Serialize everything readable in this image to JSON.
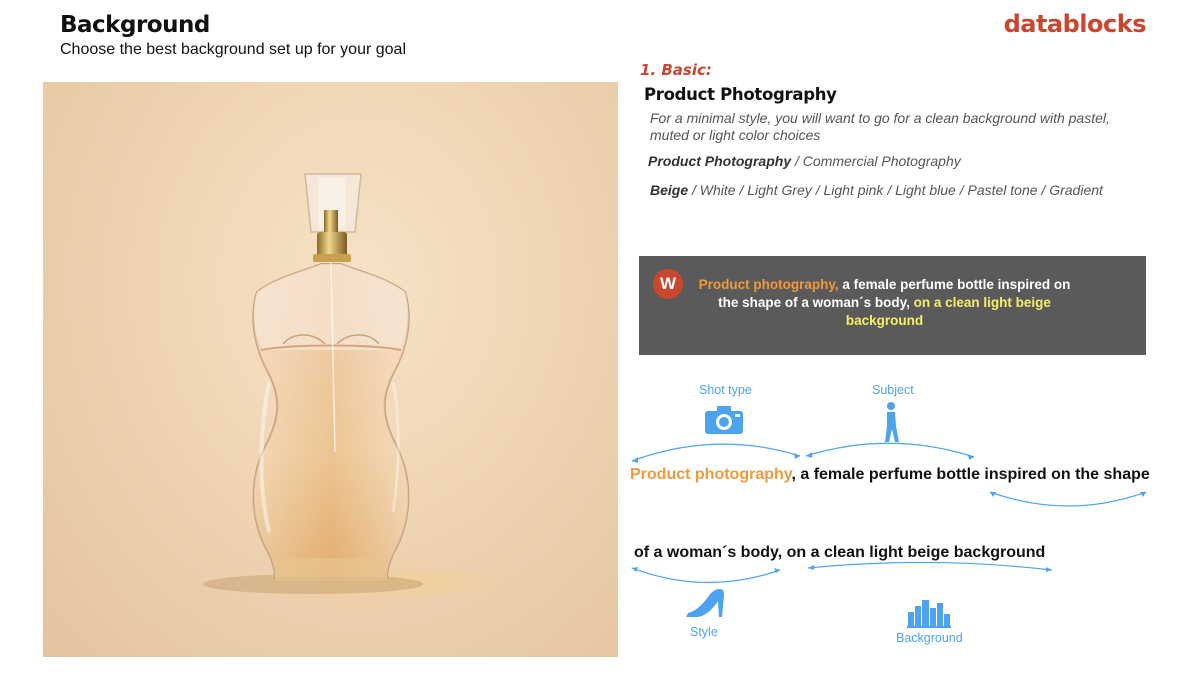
{
  "header": {
    "title": "Background",
    "subtitle": "Choose the best  background set up for your goal",
    "logo": "datablocks"
  },
  "photo": {
    "subject": "perfume-bottle"
  },
  "section": {
    "number": "1. Basic:",
    "title": "Product Photography",
    "description": "For a minimal style, you will want to go for a clean background with pastel, muted or light color choices",
    "style_bold": "Product Photography",
    "style_rest": " / Commercial Photography",
    "colors_bold": "Beige",
    "colors_rest": " / White /  Light Grey / Light pink /  Light blue /  Pastel tone / Gradient"
  },
  "prompt": {
    "icon_letter": "W",
    "part1": "Product photography,",
    "part2": " a female perfume bottle inspired on the shape of a woman´s body,",
    "part3": " on a clean light beige background"
  },
  "breakdown": {
    "shot_type_label": "Shot type",
    "subject_label": "Subject",
    "style_label": "Style",
    "background_label": "Background",
    "line1_highlight": "Product photography",
    "line1_rest": ", a female perfume bottle inspired on the shape",
    "line2": "of a woman´s body, on a clean light beige background"
  },
  "colors": {
    "accent": "#c9472e",
    "highlight_orange": "#f29a3a",
    "highlight_yellow": "#f5ef6a",
    "annotation_blue": "#4da3f0",
    "prompt_box": "#5a5a5a"
  }
}
